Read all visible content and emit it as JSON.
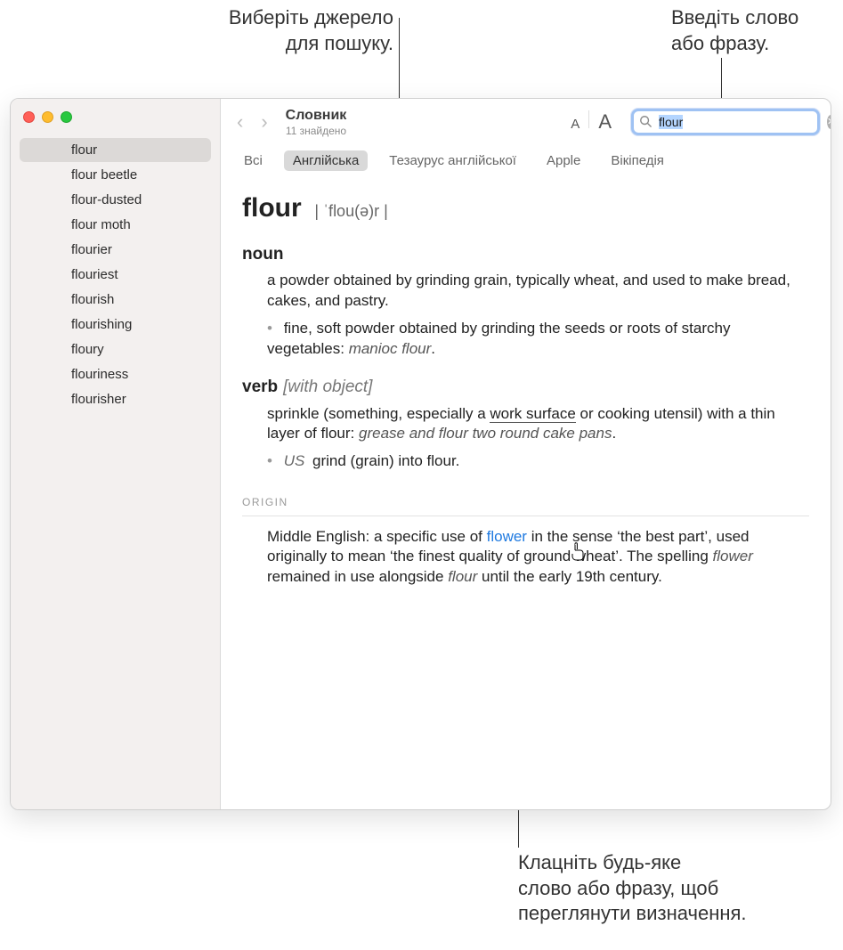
{
  "callouts": {
    "top_left": "Виберіть джерело\nдля пошуку.",
    "top_right": "Введіть слово\nабо фразу.",
    "bottom": "Клацніть будь-яке\nслово або фразу, щоб\nпереглянути визначення."
  },
  "toolbar": {
    "title": "Словник",
    "subtitle": "11 знайдено",
    "search_value": "flour"
  },
  "tabs": {
    "items": [
      "Всі",
      "Англійська",
      "Тезаурус англійської",
      "Apple",
      "Вікіпедія"
    ],
    "active_index": 1
  },
  "sidebar": {
    "items": [
      "flour",
      "flour beetle",
      "flour-dusted",
      "flour moth",
      "flourier",
      "flouriest",
      "flourish",
      "flourishing",
      "floury",
      "flouriness",
      "flourisher"
    ],
    "selected_index": 0
  },
  "entry": {
    "headword": "flour",
    "pronunciation": "| ˈflou(ə)r |",
    "noun": {
      "label": "noun",
      "def": "a powder obtained by grinding grain, typically wheat, and used to make bread, cakes, and pastry.",
      "sub_pre": "fine, soft powder obtained by grinding the seeds or roots of starchy vegetables: ",
      "sub_ex": "manioc flour",
      "sub_post": "."
    },
    "verb": {
      "label": "verb",
      "qualifier": "[with object]",
      "def_pre": "sprinkle (something, especially a ",
      "def_link": "work surface",
      "def_mid": " or cooking utensil) with a thin layer of flour: ",
      "def_ex": "grease and flour two round cake pans",
      "def_post": ".",
      "sub_region": "US",
      "sub_def": " grind (grain) into flour."
    },
    "origin": {
      "heading": "ORIGIN",
      "t1": "Middle English: a specific use of ",
      "link": "flower",
      "t2": " in the sense ‘the best part’, used originally to mean ‘the finest quality of ground wheat’. The spelling ",
      "i1": "flower",
      "t3": " remained in use alongside ",
      "i2": "flour",
      "t4": " until the early 19th century."
    }
  }
}
